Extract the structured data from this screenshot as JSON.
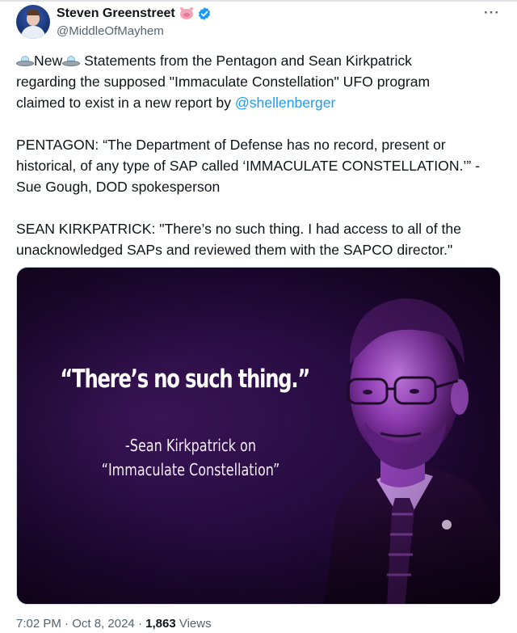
{
  "author": {
    "display_name": "Steven Greenstreet",
    "handle": "@MiddleOfMayhem"
  },
  "icons": {
    "more": "more-options-icon",
    "verified": "verified-badge-icon",
    "pig": "pig-emoji-icon",
    "ufo": "flying-saucer-emoji-icon"
  },
  "tweet": {
    "line1_new": "New",
    "line1_rest": " Statements from the Pentagon and Sean Kirkpatrick",
    "line2": "regarding the supposed \"Immaculate Constellation\" UFO program",
    "line3_prefix": "claimed to exist in a new report by ",
    "mention": "@shellenberger",
    "line4": "PENTAGON: “The Department of Defense has no record, present or",
    "line5": "historical, of any type of SAP called ‘IMMACULATE CONSTELLATION.’” -",
    "line6": "Sue Gough, DOD spokesperson",
    "line7": "SEAN KIRKPATRICK: \"There’s no such thing. I had access to all of the",
    "line8": "unacknowledged SAPs and reviewed them with the SAPCO director.\""
  },
  "media": {
    "quote": "“There’s no such thing.”",
    "attribution_line1": "-Sean Kirkpatrick on",
    "attribution_line2": "“Immaculate Constellation”"
  },
  "meta": {
    "time": "7:02 PM",
    "separator1": " · ",
    "date": "Oct 8, 2024",
    "separator2": " · ",
    "views_count": "1,863",
    "views_label": " Views"
  },
  "colors": {
    "link": "#1d9bf0",
    "secondary_text": "#536471",
    "media_tint": "#4a1a6e"
  }
}
